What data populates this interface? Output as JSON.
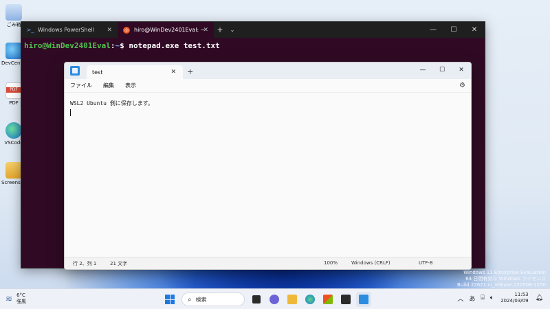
{
  "desktop": {
    "icons": [
      {
        "label": "ごみ箱",
        "icon": "recycle-bin-icon",
        "color": "#5a8bd6"
      },
      {
        "label": "DevCenter",
        "icon": "edge-dev-icon",
        "color": "#2a8fd8"
      },
      {
        "label": "PDF",
        "icon": "pdf-icon",
        "color": "#d84a3a"
      },
      {
        "label": "VSCode",
        "icon": "edge-icon",
        "color": "#1f8ad8"
      },
      {
        "label": "Screenshots",
        "icon": "folder-icon",
        "color": "#e9b540"
      }
    ]
  },
  "terminal": {
    "tabs": [
      {
        "label": "Windows PowerShell",
        "icon": "powershell-icon"
      },
      {
        "label": "hiro@WinDev2401Eval: ~",
        "icon": "ubuntu-icon"
      }
    ],
    "prompt_user": "hiro@WinDev2401Eval",
    "prompt_sep": ":",
    "prompt_path": "~",
    "prompt_symbol": "$",
    "command": "notepad.exe test.txt",
    "bg_color": "#300a24"
  },
  "notepad": {
    "tab_title": "test",
    "menu": [
      "ファイル",
      "編集",
      "表示"
    ],
    "content": "WSL2 Ubuntu 側に保存します。",
    "status": {
      "position": "行 2、列 1",
      "chars": "21 文字",
      "zoom": "100%",
      "line_ending": "Windows (CRLF)",
      "encoding": "UTF-8"
    }
  },
  "watermark": {
    "line1": "Windows 11 Enterprise Evaluation",
    "line2": "64 日間有効な Windows ライセンス",
    "line3": "Build 22621.ni_release.220506-1250"
  },
  "taskbar": {
    "weather_temp": "6°C",
    "weather_desc": "強風",
    "search_placeholder": "検索",
    "ime": "あ",
    "time": "11:53",
    "date": "2024/03/09"
  }
}
